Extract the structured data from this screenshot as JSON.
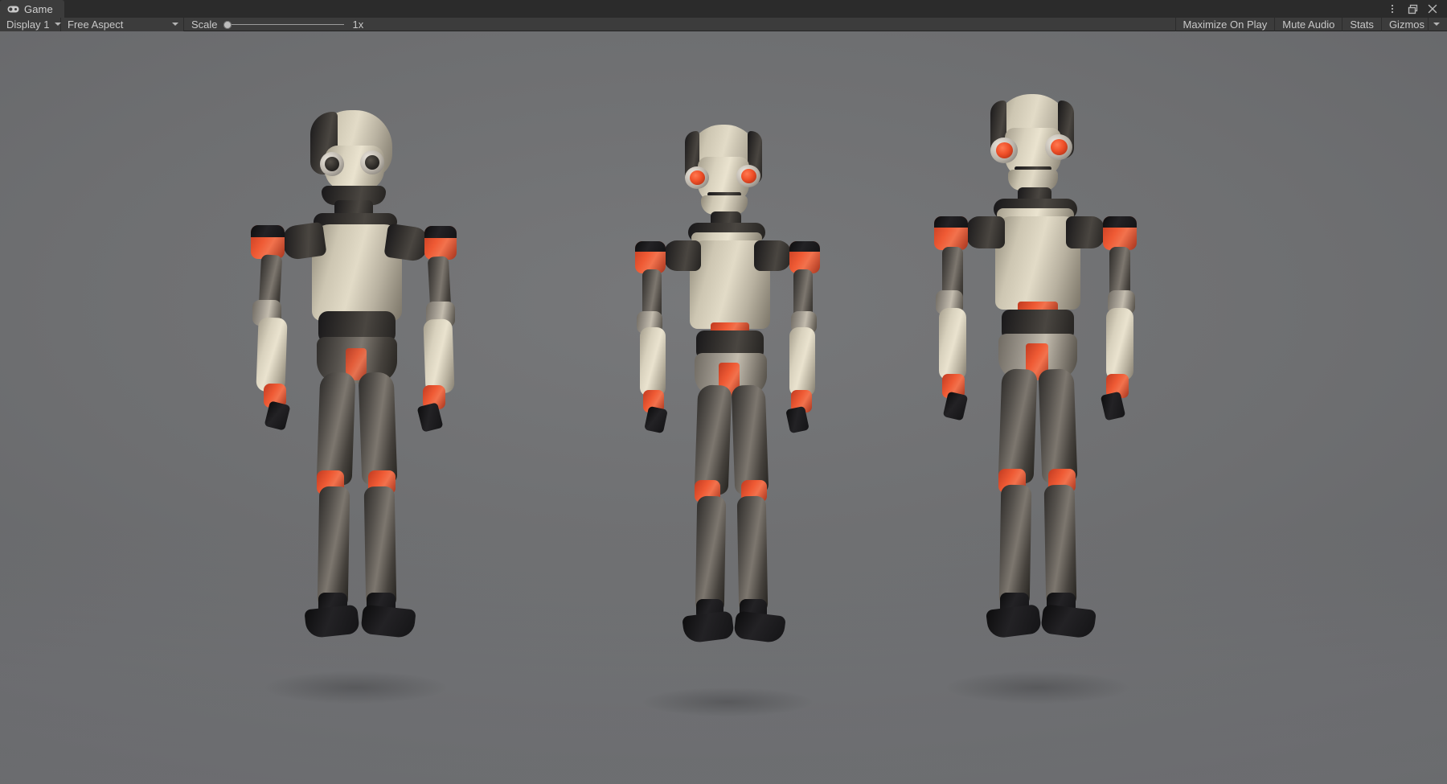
{
  "window": {
    "tab": {
      "label": "Game",
      "icon": "gamepad-icon"
    },
    "controls": {
      "menu_icon": "kebab-menu-icon",
      "maximize_icon": "restore-window-icon",
      "close_icon": "close-icon"
    }
  },
  "toolbar": {
    "display": {
      "label": "Display 1",
      "caret_icon": "chevron-down-icon"
    },
    "aspect": {
      "label": "Free Aspect",
      "caret_icon": "chevron-down-icon"
    },
    "scale": {
      "label": "Scale",
      "value": "1x",
      "knob_position_percent": 0
    },
    "maximize_on_play": "Maximize On Play",
    "mute_audio": "Mute Audio",
    "stats": "Stats",
    "gizmos": {
      "label": "Gizmos",
      "caret_icon": "chevron-down-icon"
    }
  },
  "gameview": {
    "description": "Three humanoid robot characters standing in a row on a neutral gray studio background",
    "background_color_top": "#77787a",
    "background_color_bottom": "#5d5e61",
    "accent_color": "#ef5a34",
    "plate_color": "#e2dbc7",
    "metal_color": "#7d776f",
    "robots": [
      {
        "name": "robot-left",
        "eye_color": "#2c2926",
        "eye_style": "dark",
        "pose": "front-three-quarter"
      },
      {
        "name": "robot-center",
        "eye_color": "#ef4f28",
        "eye_style": "red",
        "pose": "front"
      },
      {
        "name": "robot-right",
        "eye_color": "#ef4f28",
        "eye_style": "red",
        "pose": "front"
      }
    ]
  }
}
